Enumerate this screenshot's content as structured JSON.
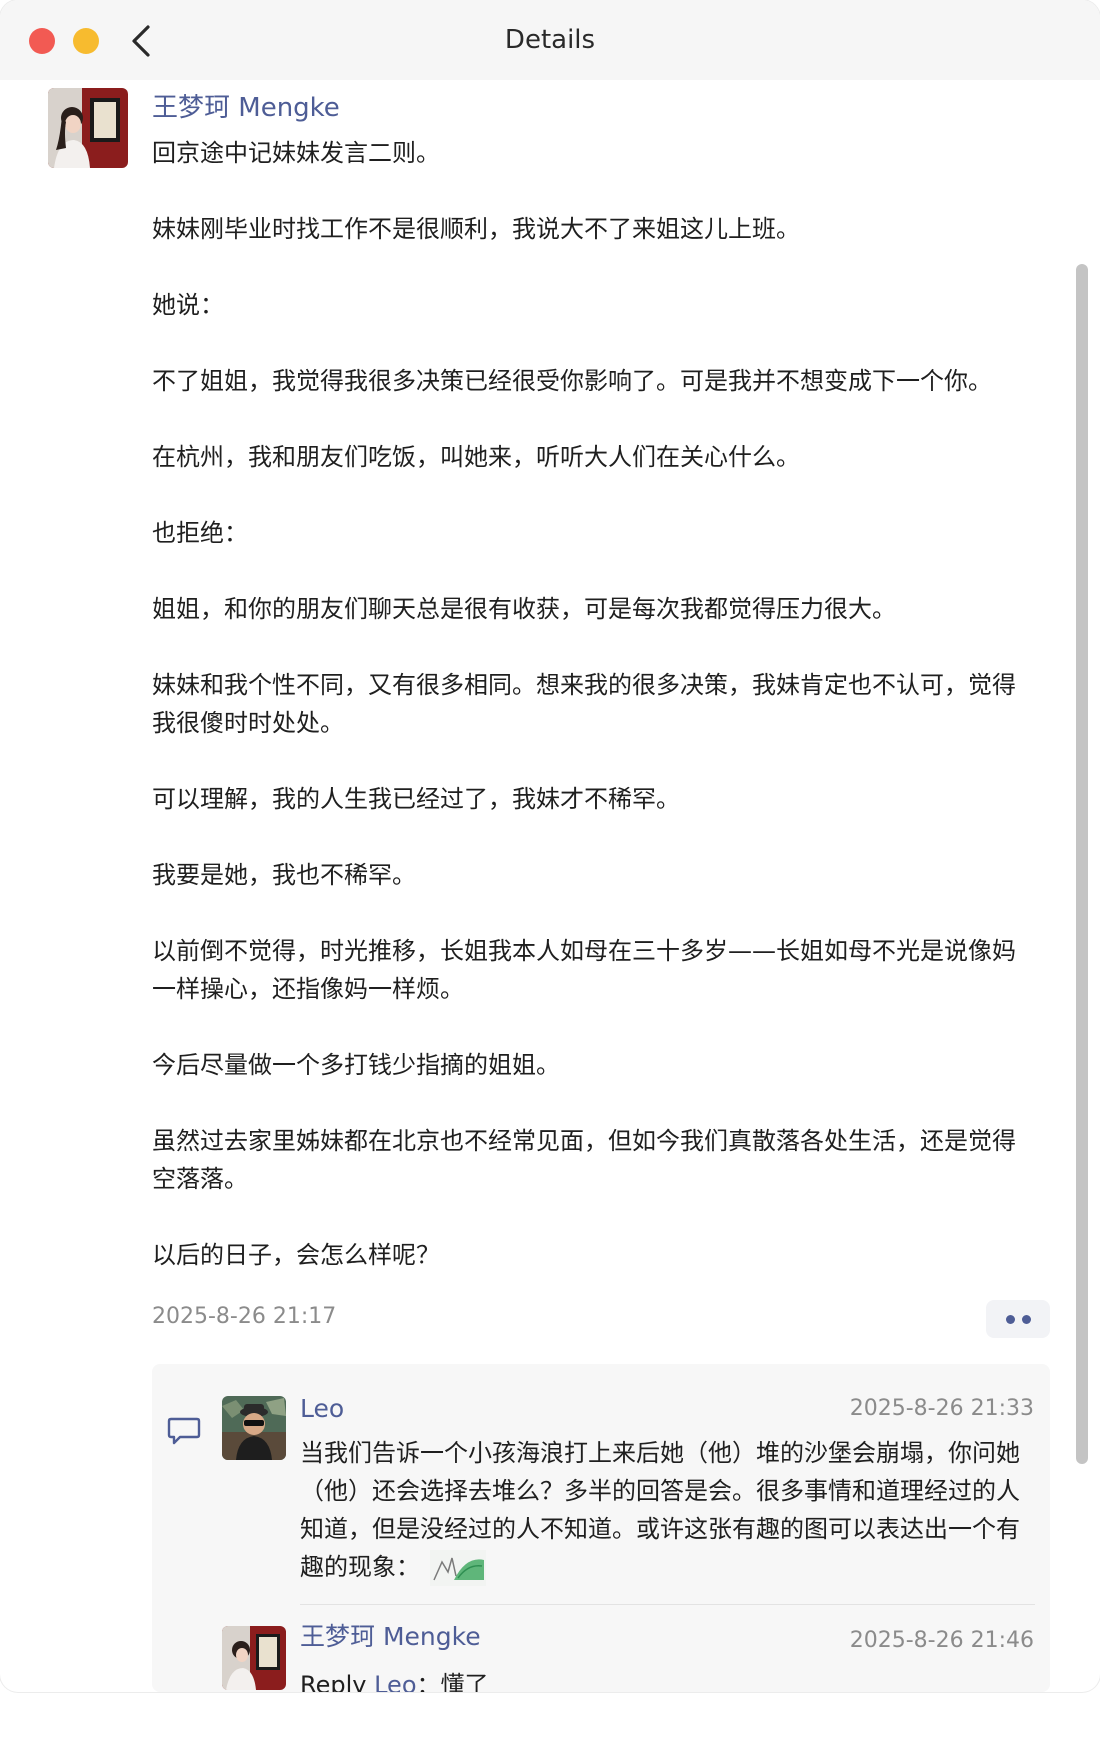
{
  "window": {
    "title": "Details"
  },
  "post": {
    "author": "王梦珂 Mengke",
    "paragraphs": [
      "回京途中记妹妹发言二则。",
      "妹妹刚毕业时找工作不是很顺利，我说大不了来姐这儿上班。",
      "她说：",
      "不了姐姐，我觉得我很多决策已经很受你影响了。可是我并不想变成下一个你。",
      "在杭州，我和朋友们吃饭，叫她来，听听大人们在关心什么。",
      "也拒绝：",
      "姐姐，和你的朋友们聊天总是很有收获，可是每次我都觉得压力很大。",
      "妹妹和我个性不同，又有很多相同。想来我的很多决策，我妹肯定也不认可，觉得我很傻时时处处。",
      "可以理解，我的人生我已经过了，我妹才不稀罕。",
      "我要是她，我也不稀罕。",
      "以前倒不觉得，时光推移，长姐我本人如母在三十多岁——长姐如母不光是说像妈一样操心，还指像妈一样烦。",
      "今后尽量做一个多打钱少指摘的姐姐。",
      "虽然过去家里姊妹都在北京也不经常见面，但如今我们真散落各处生活，还是觉得空落落。",
      "以后的日子，会怎么样呢？"
    ],
    "timestamp": "2025-8-26 21:17"
  },
  "comments": {
    "items": [
      {
        "author": "Leo",
        "time": "2025-8-26 21:33",
        "text": "当我们告诉一个小孩海浪打上来后她（他）堆的沙堡会崩塌，你问她（他）还会选择去堆么？多半的回答是会。很多事情和道理经过的人知道，但是没经过的人不知道。或许这张有趣的图可以表达出一个有趣的现象："
      },
      {
        "author": "王梦珂 Mengke",
        "time": "2025-8-26 21:46",
        "reply_prefix": "Reply ",
        "reply_target": "Leo",
        "text": "：懂了"
      }
    ]
  },
  "colors": {
    "link": "#4e5d96",
    "traffic_red": "#f25a53",
    "traffic_yellow": "#f7bb2f",
    "muted": "#8b8b8b"
  }
}
